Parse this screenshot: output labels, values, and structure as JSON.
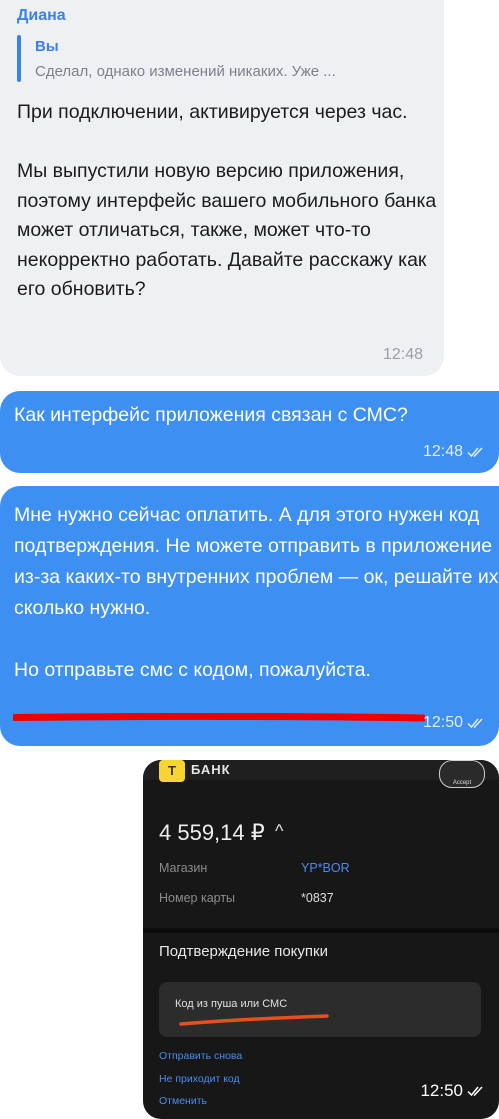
{
  "incoming": {
    "sender": "Диана",
    "reply_author": "Вы",
    "reply_preview": "Сделал, однако изменений никаких. Уже ...",
    "text": "При подключении, активируется через час.\n\nМы выпустили новую версию приложения, поэтому интерфейс вашего мобильного банка может отличаться, также, может что-то некорректно работать. Давайте расскажу как его обновить?",
    "time": "12:48"
  },
  "outgoing": [
    {
      "text": "Как интерфейс приложения связан с СМС?",
      "time": "12:48"
    },
    {
      "text": "Мне нужно сейчас оплатить. А для этого нужен код подтверждения.  Не можете отправить в приложение из-за каких-то внутренних проблем — ок, решайте их сколько нужно.\n\nНо отправьте смс с кодом, пожалуйста.",
      "time": "12:50"
    }
  ],
  "screenshot": {
    "logo": "Т",
    "bank_name": "БАНК",
    "accept": "Accept",
    "amount": "4 559,14 ₽",
    "caret": "^",
    "shop_label": "Магазин",
    "shop_value": "YP*BOR",
    "card_label": "Номер карты",
    "card_value": "*0837",
    "confirm_title": "Подтверждение покупки",
    "code_placeholder": "Код из пуша или СМС",
    "link_resend": "Отправить снова",
    "link_no_code": "Не приходит код",
    "link_cancel": "Отменить",
    "time": "12:50"
  },
  "colors": {
    "incoming_bg": "#eff0f4",
    "outgoing_bg": "#3d8ff2",
    "accent": "#3a82e6",
    "red_mark": "#ee0000",
    "orange_mark": "#e5501e"
  },
  "icons": [
    "double-check-icon"
  ]
}
